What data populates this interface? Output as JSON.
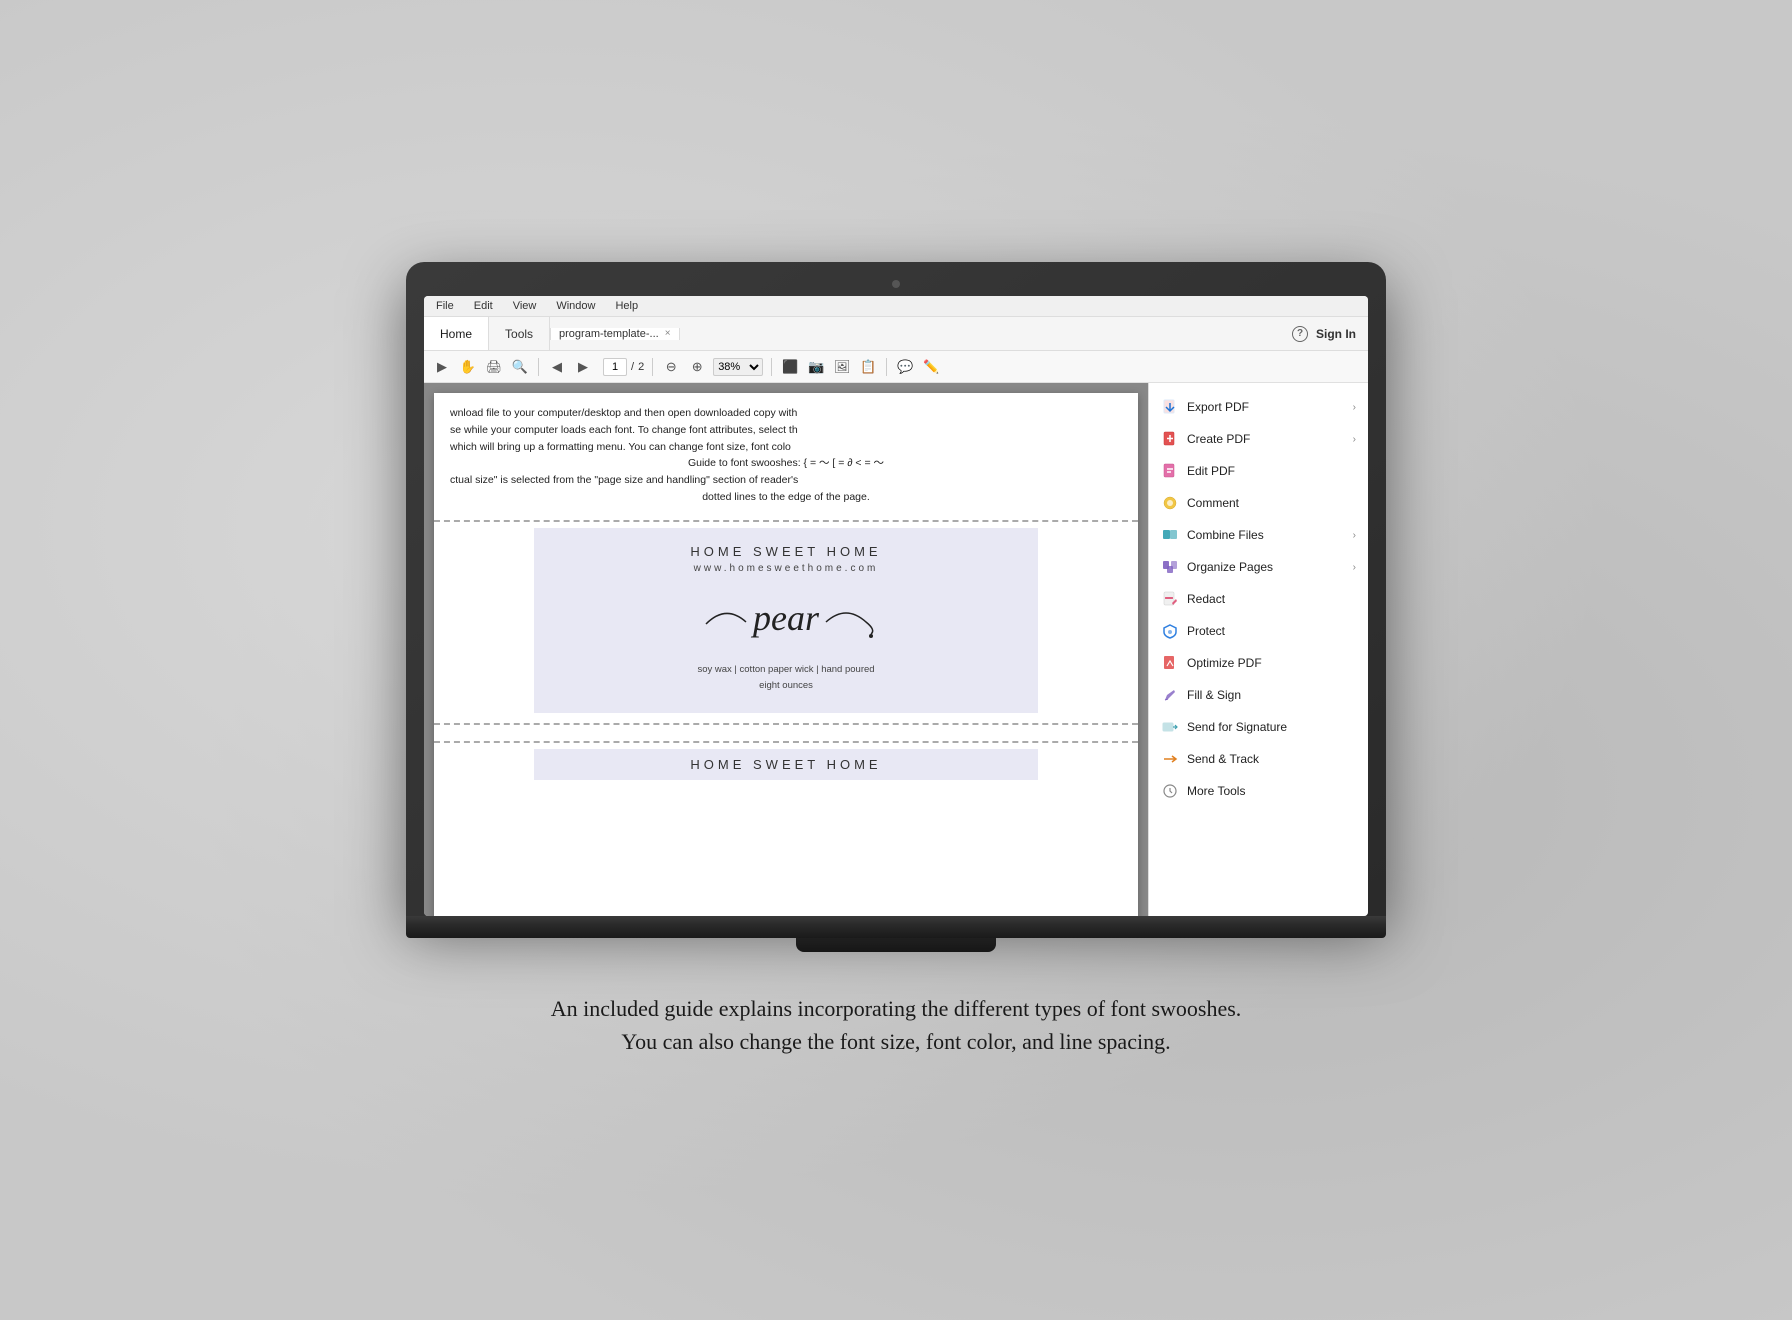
{
  "laptop": {
    "screen": {
      "menubar": {
        "items": [
          "File",
          "Edit",
          "View",
          "Window",
          "Help"
        ]
      },
      "tabs": [
        {
          "label": "Home",
          "active": true
        },
        {
          "label": "Tools",
          "active": false
        }
      ],
      "file_tab": {
        "name": "program-template-...",
        "close": "×"
      },
      "sign_in": {
        "help": "?",
        "label": "Sign In"
      },
      "toolbar": {
        "page_current": "1",
        "page_total": "2",
        "zoom": "38%"
      },
      "pdf": {
        "text_lines": [
          "wnload file to your computer/desktop and then open downloaded copy with",
          "se while your computer loads each font. To change font attributes, select th",
          "which will bring up a formatting menu.  You can change font size, font colo",
          "Guide to font swooshes:  {  =  ~     [  =  ∂   <  =  ~",
          "ctual size\" is selected from the \"page size and handling\" section of reader's",
          "dotted lines to the edge of the page."
        ],
        "label": {
          "title": "HOME SWEET HOME",
          "url": "www.homesweethome.com",
          "script_text": "pear",
          "desc_line1": "soy wax | cotton paper wick | hand poured",
          "desc_line2": "eight ounces"
        },
        "bottom_title": "HOME SWEET HOME"
      },
      "right_panel": {
        "items": [
          {
            "id": "export_pdf",
            "label": "Export PDF",
            "icon": "export",
            "color": "blue",
            "has_arrow": true
          },
          {
            "id": "create_pdf",
            "label": "Create PDF",
            "icon": "create",
            "color": "red",
            "has_arrow": true
          },
          {
            "id": "edit_pdf",
            "label": "Edit PDF",
            "icon": "edit",
            "color": "pink",
            "has_arrow": false
          },
          {
            "id": "comment",
            "label": "Comment",
            "icon": "comment",
            "color": "yellow",
            "has_arrow": false
          },
          {
            "id": "combine_files",
            "label": "Combine Files",
            "icon": "combine",
            "color": "teal",
            "has_arrow": true
          },
          {
            "id": "organize_pages",
            "label": "Organize Pages",
            "icon": "organize",
            "color": "purple",
            "has_arrow": true
          },
          {
            "id": "redact",
            "label": "Redact",
            "icon": "redact",
            "color": "pink2",
            "has_arrow": false
          },
          {
            "id": "protect",
            "label": "Protect",
            "icon": "protect",
            "color": "blue2",
            "has_arrow": false
          },
          {
            "id": "optimize_pdf",
            "label": "Optimize PDF",
            "icon": "optimize",
            "color": "red2",
            "has_arrow": false
          },
          {
            "id": "fill_sign",
            "label": "Fill & Sign",
            "icon": "fill",
            "color": "purple2",
            "has_arrow": false
          },
          {
            "id": "send_signature",
            "label": "Send for Signature",
            "icon": "send_sig",
            "color": "teal2",
            "has_arrow": false
          },
          {
            "id": "send_track",
            "label": "Send & Track",
            "icon": "send_track",
            "color": "orange",
            "has_arrow": false
          },
          {
            "id": "more_tools",
            "label": "More Tools",
            "icon": "more",
            "color": "gray",
            "has_arrow": false
          }
        ]
      }
    }
  },
  "caption": {
    "line1": "An included guide explains incorporating the different types of font swooshes.",
    "line2": "You can also change the font size, font color, and line spacing."
  }
}
